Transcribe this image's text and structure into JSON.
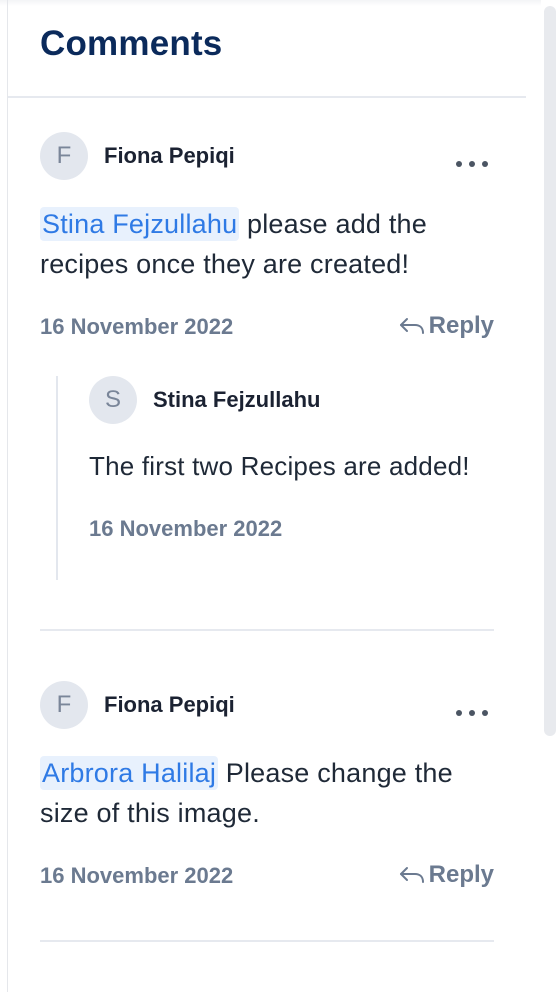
{
  "panel": {
    "title": "Comments"
  },
  "comments": [
    {
      "avatar_initial": "F",
      "author": "Fiona Pepiqi",
      "mention": "Stina Fejzullahu",
      "text": " please add the recipes once they are created!",
      "date": "16 November 2022",
      "reply_label": "Reply",
      "replies": [
        {
          "avatar_initial": "S",
          "author": "Stina Fejzullahu",
          "text": "The first two Recipes are added!",
          "date": "16 November 2022"
        }
      ]
    },
    {
      "avatar_initial": "F",
      "author": "Fiona Pepiqi",
      "mention": "Arbrora Halilaj",
      "text": " Please change the size of this image.",
      "date": "16 November 2022",
      "reply_label": "Reply"
    }
  ],
  "icons": {
    "more": "more-horizontal-icon",
    "reply": "reply-arrow-icon"
  },
  "colors": {
    "title": "#0b2a5b",
    "mention_bg": "#e8f1fd",
    "mention_text": "#2f7ae5",
    "muted": "#6b7a90"
  }
}
